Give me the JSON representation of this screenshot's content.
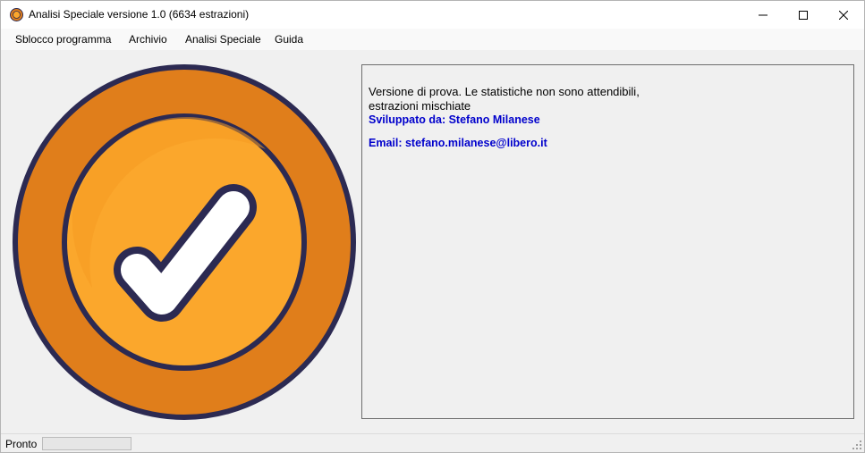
{
  "window": {
    "title": "Analisi Speciale versione 1.0 (6634 estrazioni)"
  },
  "menu": {
    "items": [
      "Sblocco programma",
      "Archivio",
      "Analisi Speciale",
      "Guida"
    ]
  },
  "info": {
    "line1": "Versione di prova. Le statistiche non sono attendibili,",
    "line2": "estrazioni mischiate",
    "developer": "Sviluppato da: Stefano Milanese",
    "email": "Email: stefano.milanese@libero.it"
  },
  "status": {
    "label": "Pronto",
    "progress_percent": 0
  },
  "colors": {
    "badge_outer": "#e07e1b",
    "badge_inner": "#fba72c",
    "badge_outline": "#2c2a52",
    "info_blue": "#0000cc"
  },
  "icons": {
    "app": "app-icon",
    "minimize": "minimize-icon",
    "maximize": "maximize-icon",
    "close": "close-icon",
    "badge": "checkmark-badge-icon"
  }
}
